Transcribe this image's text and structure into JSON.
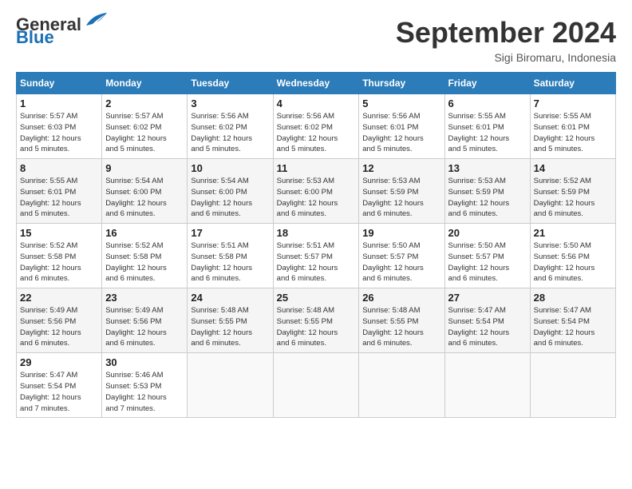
{
  "header": {
    "logo_line1": "General",
    "logo_line2": "Blue",
    "month_title": "September 2024",
    "subtitle": "Sigi Biromaru, Indonesia"
  },
  "days_of_week": [
    "Sunday",
    "Monday",
    "Tuesday",
    "Wednesday",
    "Thursday",
    "Friday",
    "Saturday"
  ],
  "weeks": [
    [
      {
        "day": "1",
        "info": "Sunrise: 5:57 AM\nSunset: 6:03 PM\nDaylight: 12 hours\nand 5 minutes."
      },
      {
        "day": "2",
        "info": "Sunrise: 5:57 AM\nSunset: 6:02 PM\nDaylight: 12 hours\nand 5 minutes."
      },
      {
        "day": "3",
        "info": "Sunrise: 5:56 AM\nSunset: 6:02 PM\nDaylight: 12 hours\nand 5 minutes."
      },
      {
        "day": "4",
        "info": "Sunrise: 5:56 AM\nSunset: 6:02 PM\nDaylight: 12 hours\nand 5 minutes."
      },
      {
        "day": "5",
        "info": "Sunrise: 5:56 AM\nSunset: 6:01 PM\nDaylight: 12 hours\nand 5 minutes."
      },
      {
        "day": "6",
        "info": "Sunrise: 5:55 AM\nSunset: 6:01 PM\nDaylight: 12 hours\nand 5 minutes."
      },
      {
        "day": "7",
        "info": "Sunrise: 5:55 AM\nSunset: 6:01 PM\nDaylight: 12 hours\nand 5 minutes."
      }
    ],
    [
      {
        "day": "8",
        "info": "Sunrise: 5:55 AM\nSunset: 6:01 PM\nDaylight: 12 hours\nand 5 minutes."
      },
      {
        "day": "9",
        "info": "Sunrise: 5:54 AM\nSunset: 6:00 PM\nDaylight: 12 hours\nand 6 minutes."
      },
      {
        "day": "10",
        "info": "Sunrise: 5:54 AM\nSunset: 6:00 PM\nDaylight: 12 hours\nand 6 minutes."
      },
      {
        "day": "11",
        "info": "Sunrise: 5:53 AM\nSunset: 6:00 PM\nDaylight: 12 hours\nand 6 minutes."
      },
      {
        "day": "12",
        "info": "Sunrise: 5:53 AM\nSunset: 5:59 PM\nDaylight: 12 hours\nand 6 minutes."
      },
      {
        "day": "13",
        "info": "Sunrise: 5:53 AM\nSunset: 5:59 PM\nDaylight: 12 hours\nand 6 minutes."
      },
      {
        "day": "14",
        "info": "Sunrise: 5:52 AM\nSunset: 5:59 PM\nDaylight: 12 hours\nand 6 minutes."
      }
    ],
    [
      {
        "day": "15",
        "info": "Sunrise: 5:52 AM\nSunset: 5:58 PM\nDaylight: 12 hours\nand 6 minutes."
      },
      {
        "day": "16",
        "info": "Sunrise: 5:52 AM\nSunset: 5:58 PM\nDaylight: 12 hours\nand 6 minutes."
      },
      {
        "day": "17",
        "info": "Sunrise: 5:51 AM\nSunset: 5:58 PM\nDaylight: 12 hours\nand 6 minutes."
      },
      {
        "day": "18",
        "info": "Sunrise: 5:51 AM\nSunset: 5:57 PM\nDaylight: 12 hours\nand 6 minutes."
      },
      {
        "day": "19",
        "info": "Sunrise: 5:50 AM\nSunset: 5:57 PM\nDaylight: 12 hours\nand 6 minutes."
      },
      {
        "day": "20",
        "info": "Sunrise: 5:50 AM\nSunset: 5:57 PM\nDaylight: 12 hours\nand 6 minutes."
      },
      {
        "day": "21",
        "info": "Sunrise: 5:50 AM\nSunset: 5:56 PM\nDaylight: 12 hours\nand 6 minutes."
      }
    ],
    [
      {
        "day": "22",
        "info": "Sunrise: 5:49 AM\nSunset: 5:56 PM\nDaylight: 12 hours\nand 6 minutes."
      },
      {
        "day": "23",
        "info": "Sunrise: 5:49 AM\nSunset: 5:56 PM\nDaylight: 12 hours\nand 6 minutes."
      },
      {
        "day": "24",
        "info": "Sunrise: 5:48 AM\nSunset: 5:55 PM\nDaylight: 12 hours\nand 6 minutes."
      },
      {
        "day": "25",
        "info": "Sunrise: 5:48 AM\nSunset: 5:55 PM\nDaylight: 12 hours\nand 6 minutes."
      },
      {
        "day": "26",
        "info": "Sunrise: 5:48 AM\nSunset: 5:55 PM\nDaylight: 12 hours\nand 6 minutes."
      },
      {
        "day": "27",
        "info": "Sunrise: 5:47 AM\nSunset: 5:54 PM\nDaylight: 12 hours\nand 6 minutes."
      },
      {
        "day": "28",
        "info": "Sunrise: 5:47 AM\nSunset: 5:54 PM\nDaylight: 12 hours\nand 6 minutes."
      }
    ],
    [
      {
        "day": "29",
        "info": "Sunrise: 5:47 AM\nSunset: 5:54 PM\nDaylight: 12 hours\nand 7 minutes."
      },
      {
        "day": "30",
        "info": "Sunrise: 5:46 AM\nSunset: 5:53 PM\nDaylight: 12 hours\nand 7 minutes."
      },
      {
        "day": "",
        "info": ""
      },
      {
        "day": "",
        "info": ""
      },
      {
        "day": "",
        "info": ""
      },
      {
        "day": "",
        "info": ""
      },
      {
        "day": "",
        "info": ""
      }
    ]
  ]
}
